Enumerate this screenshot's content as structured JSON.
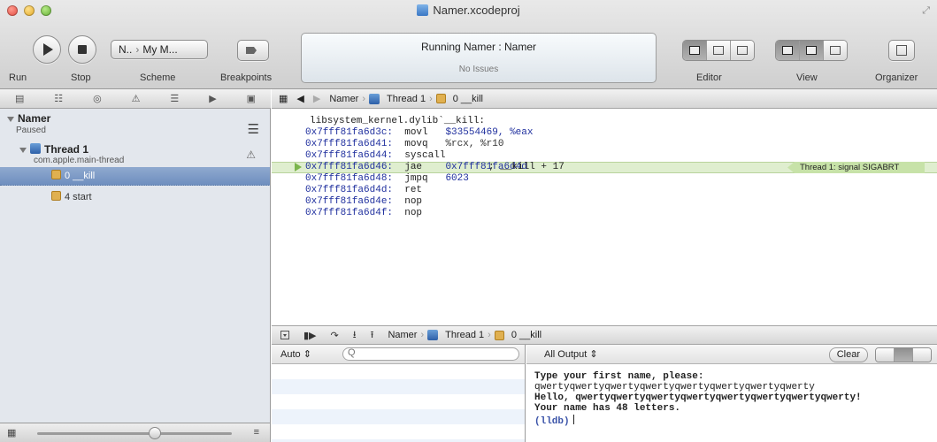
{
  "window": {
    "title": "Namer.xcodeproj"
  },
  "toolbar": {
    "run_label": "Run",
    "stop_label": "Stop",
    "scheme_label": "Scheme",
    "breakpoints_label": "Breakpoints",
    "scheme_target": "N..",
    "scheme_destination": "My M...",
    "activity_main": "Running Namer : Namer",
    "activity_sub": "No Issues",
    "editor_label": "Editor",
    "view_label": "View",
    "organizer_label": "Organizer"
  },
  "navigator": {
    "process_name": "Namer",
    "process_status": "Paused",
    "thread_name": "Thread 1",
    "thread_queue": "com.apple.main-thread",
    "frames": [
      {
        "label": "0 __kill",
        "selected": true
      },
      {
        "label": "4 start",
        "selected": false
      }
    ]
  },
  "jumpbar": {
    "crumbs": [
      "Namer",
      "Thread 1",
      "0 __kill"
    ]
  },
  "editor": {
    "header": "libsystem_kernel.dylib`__kill:",
    "lines": [
      {
        "addr": "0x7fff81fa6d3c:",
        "op": "movl",
        "args": "$33554469, %eax",
        "comment": ""
      },
      {
        "addr": "0x7fff81fa6d41:",
        "op": "movq",
        "args": "%rcx, %r10",
        "comment": ""
      },
      {
        "addr": "0x7fff81fa6d44:",
        "op": "syscall",
        "args": "",
        "comment": ""
      },
      {
        "addr": "0x7fff81fa6d46:",
        "op": "jae",
        "args": "0x7fff81fa6d4d",
        "comment": "; __kill + 17"
      },
      {
        "addr": "0x7fff81fa6d48:",
        "op": "jmpq",
        "args": "6023",
        "comment": ""
      },
      {
        "addr": "0x7fff81fa6d4d:",
        "op": "ret",
        "args": "",
        "comment": ""
      },
      {
        "addr": "0x7fff81fa6d4e:",
        "op": "nop",
        "args": "",
        "comment": ""
      },
      {
        "addr": "0x7fff81fa6d4f:",
        "op": "nop",
        "args": "",
        "comment": ""
      }
    ],
    "signal_badge": "Thread 1: signal SIGABRT"
  },
  "debugbar": {
    "crumbs": [
      "Namer",
      "Thread 1",
      "0 __kill"
    ]
  },
  "variables": {
    "scope": "Auto",
    "search_placeholder": "Q"
  },
  "console": {
    "filter": "All Output",
    "clear_label": "Clear",
    "lines": [
      "Type your first name, please:",
      "qwertyqwertyqwertyqwertyqwertyqwertyqwertyqwerty",
      "Hello, qwertyqwertyqwertyqwertyqwertyqwertyqwertyqwerty!",
      "Your name has 48 letters.",
      "(lldb)"
    ]
  },
  "colors": {
    "selection": "#7f9cc8",
    "highlight": "#dfeecf",
    "signal_badge": "#c7e2a8",
    "address": "#1f2f9e"
  }
}
